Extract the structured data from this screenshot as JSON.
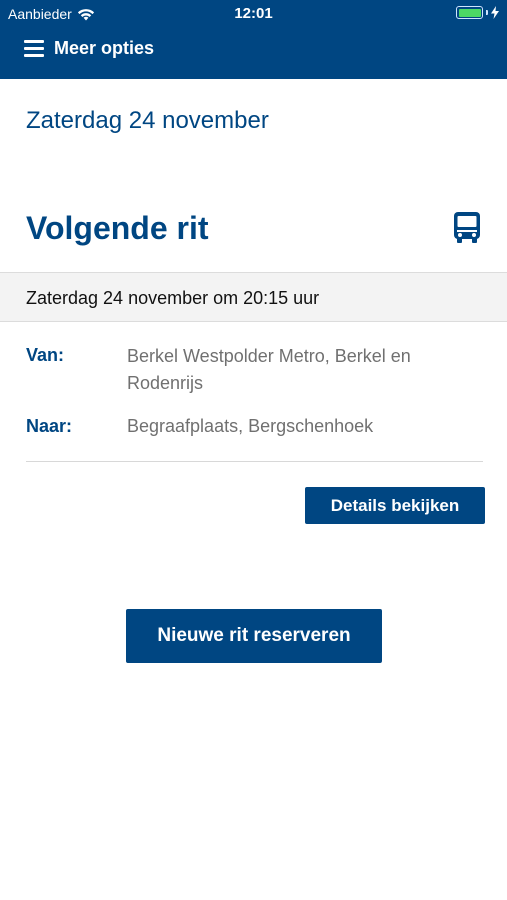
{
  "status_bar": {
    "carrier": "Aanbieder",
    "time": "12:01",
    "wifi_icon": "wifi-icon",
    "battery_icon": "battery-icon",
    "battery_level": 1.0,
    "charging_icon": "charging-bolt-icon"
  },
  "header": {
    "menu_icon": "hamburger-menu-icon",
    "menu_label": "Meer opties"
  },
  "main": {
    "date_heading": "Zaterdag 24 november",
    "next_ride_title": "Volgende rit",
    "bus_icon": "bus-icon",
    "ride_datetime": "Zaterdag 24 november om 20:15 uur",
    "from_label": "Van:",
    "from_value": "Berkel Westpolder Metro, Berkel en Rodenrijs",
    "to_label": "Naar:",
    "to_value": "Begraafplaats, Bergschenhoek",
    "details_button": "Details bekijken",
    "new_ride_button": "Nieuwe rit reserveren"
  },
  "colors": {
    "brand": "#004682",
    "band_bg": "#f3f3f3",
    "value_text": "#707070",
    "battery": "#4cd964"
  }
}
